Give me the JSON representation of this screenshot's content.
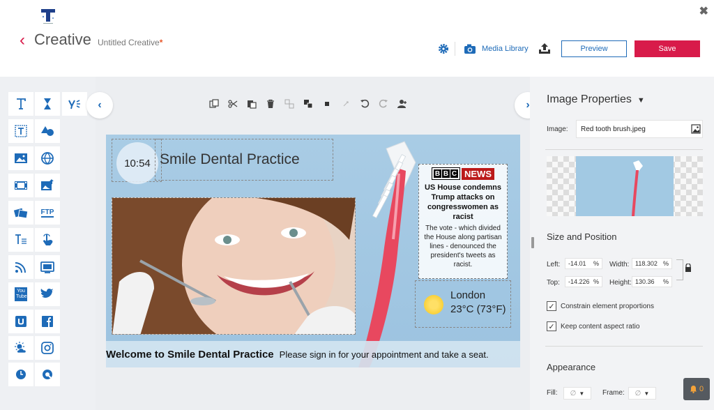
{
  "header": {
    "logo_icon": "brand-t-logo",
    "back_icon": "chevron-left-icon",
    "title": "Creative",
    "subtitle": "Untitled Creative",
    "unsaved_marker": "*",
    "close_icon": "close-icon",
    "settings_icon": "gear-icon",
    "media_icon": "camera-icon",
    "media_label": "Media Library",
    "upload_icon": "upload-icon",
    "preview_label": "Preview",
    "save_label": "Save"
  },
  "toolbox": {
    "tools": [
      "text-icon",
      "hourglass-icon",
      "yammer-icon",
      "text-frame-icon",
      "shapes-icon",
      "image-icon",
      "globe-icon",
      "video-icon",
      "image-upload-icon",
      "slideshow-icon",
      "ftp-icon",
      "text-list-icon",
      "touch-icon",
      "rss-icon",
      "tv-icon",
      "youtube-icon",
      "twitter-icon",
      "ustream-icon",
      "facebook-icon",
      "weather-icon",
      "instagram-icon",
      "clock-icon",
      "queue-icon"
    ],
    "ftp_label": "FTP",
    "youtube_label": "You Tube"
  },
  "edit_toolbar": {
    "tools": [
      "duplicate-icon",
      "cut-icon",
      "paste-icon",
      "delete-icon",
      "bring-front-icon",
      "send-back-icon",
      "stop-icon",
      "fit-icon",
      "undo-icon",
      "redo-icon",
      "add-user-icon"
    ]
  },
  "canvas": {
    "clock_time": "10:54",
    "title_text": "Smile Dental Practice",
    "news": {
      "brand_letters": [
        "B",
        "B",
        "C"
      ],
      "brand_word": "NEWS",
      "headline": "US House condemns Trump attacks on congresswomen as racist",
      "body": "The vote - which divided the House along partisan lines - denounced the president's tweets as racist."
    },
    "weather": {
      "city": "London",
      "temperature": "23°C (73°F)"
    },
    "ticker": {
      "bold": "Welcome to Smile Dental Practice",
      "normal": "Please sign in for your appointment and take a seat."
    },
    "colors": {
      "background": "#a9cce5",
      "toothbrush": "#e8485f",
      "bristles": "#ffffff"
    }
  },
  "panel": {
    "title": "Image Properties",
    "image_label": "Image:",
    "image_value": "Red tooth brush.jpeg",
    "image_picker_icon": "image-picker-icon",
    "size_title": "Size and Position",
    "left_label": "Left:",
    "left_value": "-14.01",
    "top_label": "Top:",
    "top_value": "-14.226",
    "width_label": "Width:",
    "width_value": "118.302",
    "height_label": "Height:",
    "height_value": "130.36",
    "unit": "%",
    "constrain_label": "Constrain element proportions",
    "constrain_checked": true,
    "aspect_label": "Keep content aspect ratio",
    "aspect_checked": true,
    "appearance_title": "Appearance",
    "fill_label": "Fill:",
    "frame_label": "Frame:",
    "empty_symbol": "∅",
    "lock_icon": "lock-icon"
  },
  "notifications": {
    "icon": "bell-icon",
    "count": "0"
  },
  "colors": {
    "accent": "#d81b4a",
    "brand_blue": "#1e6bb8"
  }
}
